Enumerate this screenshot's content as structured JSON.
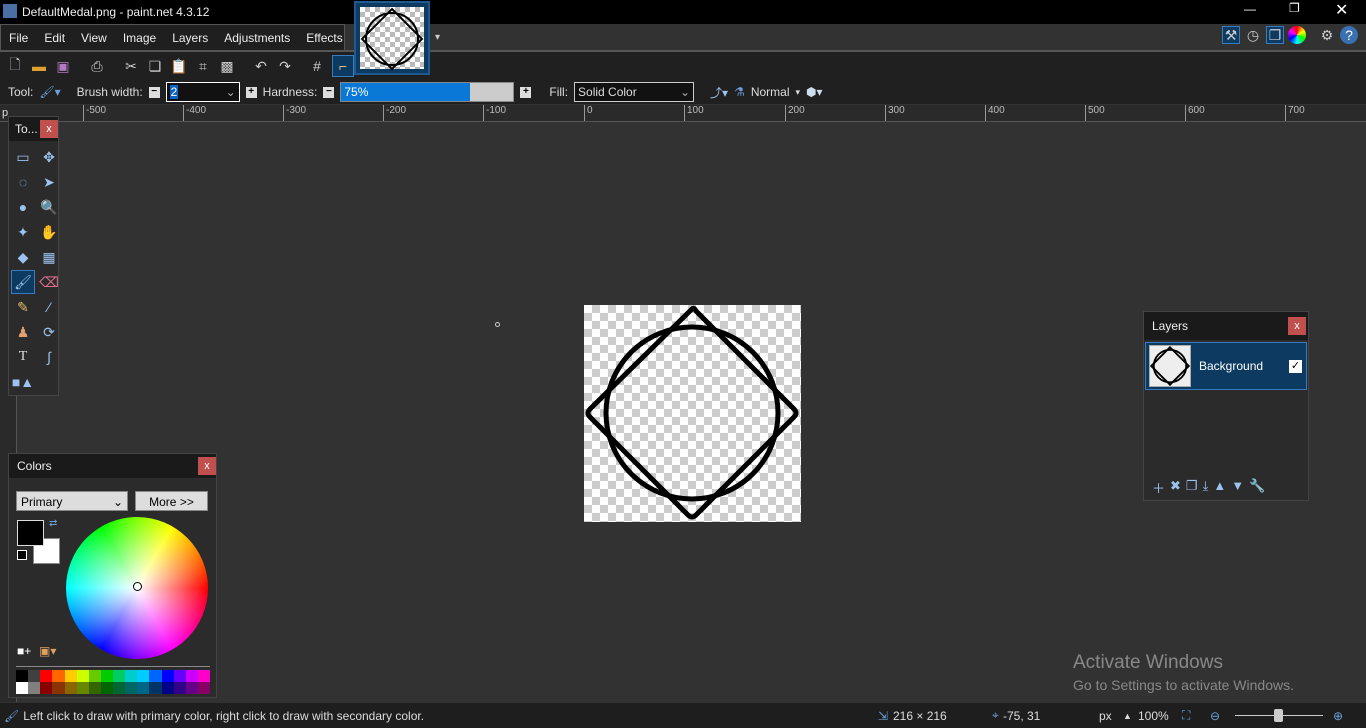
{
  "window": {
    "title": "DefaultMedal.png - paint.net 4.3.12"
  },
  "menu": [
    "File",
    "Edit",
    "View",
    "Image",
    "Layers",
    "Adjustments",
    "Effects"
  ],
  "toolbar": {
    "icons": [
      "new-icon",
      "open-icon",
      "save-icon",
      "print-icon",
      "cut-icon",
      "copy-icon",
      "paste-icon",
      "crop-icon",
      "deselect-icon",
      "undo-icon",
      "redo-icon",
      "grid-icon",
      "ruler-icon"
    ]
  },
  "options": {
    "tool_label": "Tool:",
    "brush_width_label": "Brush width:",
    "brush_width": "2",
    "hardness_label": "Hardness:",
    "hardness": "75%",
    "hardness_fraction": 0.75,
    "fill_label": "Fill:",
    "fill": "Solid Color",
    "blend_mode": "Normal"
  },
  "ruler": [
    "-500",
    "-400",
    "-300",
    "-200",
    "-100",
    "0",
    "100",
    "200",
    "300",
    "400",
    "500",
    "600",
    "700"
  ],
  "tools_panel": {
    "title": "To..."
  },
  "colors_panel": {
    "title": "Colors",
    "mode": "Primary",
    "more_button": "More >>",
    "primary": "#000000",
    "secondary": "#ffffff"
  },
  "layers_panel": {
    "title": "Layers",
    "layers": [
      {
        "name": "Background",
        "visible": true
      }
    ]
  },
  "status": {
    "hint": "Left click to draw with primary color, right click to draw with secondary color.",
    "size": "216 × 216",
    "cursor": "-75, 31",
    "units": "px",
    "zoom": "100%"
  },
  "watermark": {
    "line1": "Activate Windows",
    "line2": "Go to Settings to activate Windows."
  }
}
